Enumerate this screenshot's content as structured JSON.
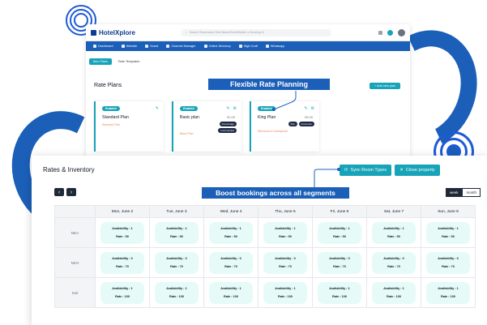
{
  "app": {
    "logo_text": "HotelXplore",
    "search_placeholder": "Search Reservation Web Name/Email/Mobile or Booking Id",
    "nav_items": [
      "Dashboard",
      "Website",
      "Guest",
      "Channel Manager",
      "Online Directory",
      "High Craft",
      "Whatsapp"
    ]
  },
  "rate_plans_window": {
    "breadcrumb_button": "Item Plans",
    "breadcrumb_current": "Rate Templates",
    "title": "Rate Plans",
    "add_button": "+ Add new plan",
    "plans": [
      {
        "badge": "Enabled",
        "name": "Standard Plan",
        "price": "",
        "subtitle": "Standard Plan",
        "tags": []
      },
      {
        "badge": "Enabled",
        "name": "Basic plan",
        "price": "00.00",
        "subtitle": "Basic Plan",
        "tags": [
          "Percentage",
          "Incremented"
        ]
      },
      {
        "badge": "Enabled",
        "name": "King Plan",
        "price": "99.00",
        "subtitle": "Welcome to Hotelxplore",
        "tags": [
          "Flat",
          "Increment"
        ]
      }
    ]
  },
  "callouts": {
    "flexible": "Flexible Rate Planning",
    "boost": "Boost bookings across all segments"
  },
  "rates_window": {
    "title": "Rates & Inventory",
    "sync_button": "Sync Room Types",
    "close_button": "Close property",
    "prev_arrow": "‹",
    "next_arrow": "›",
    "view_week": "week",
    "view_month": "month",
    "columns": [
      "Mon, June 2",
      "Tue, June 3",
      "Wed, June 4",
      "Thu, June 5",
      "Fri, June 6",
      "Sat, June 7",
      "Sun, June 8"
    ],
    "rows": [
      {
        "room": "NEA",
        "availability": "Availability : 1",
        "rate": "Rate : 50"
      },
      {
        "room": "NKO",
        "availability": "Availability : 0",
        "rate": "Rate : 70"
      },
      {
        "room": "Suit",
        "availability": "Availability : 1",
        "rate": "Rate : 100"
      }
    ]
  },
  "colors": {
    "brand_blue": "#1b5fb8",
    "teal": "#17a3b8",
    "cell_bg": "#e6fbf8"
  }
}
